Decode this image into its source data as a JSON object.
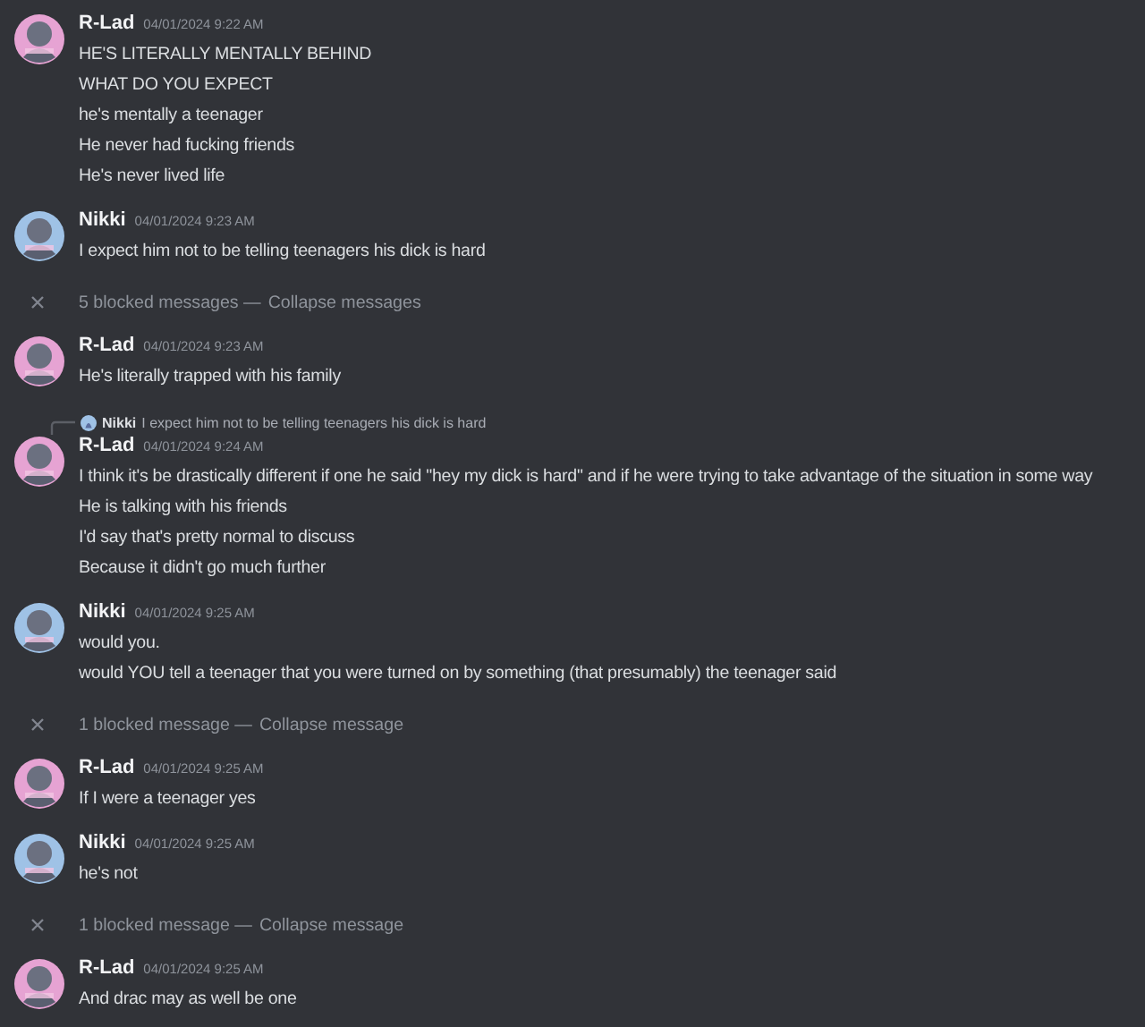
{
  "messages": [
    {
      "kind": "message",
      "author": "R-Lad",
      "timestamp": "04/01/2024 9:22 AM",
      "color": "#e6a3d3",
      "lines": [
        "HE'S LITERALLY MENTALLY BEHIND",
        "WHAT DO YOU EXPECT",
        "he's mentally a teenager",
        "He never had fucking friends",
        "He's never lived life"
      ]
    },
    {
      "kind": "message",
      "author": "Nikki",
      "timestamp": "04/01/2024 9:23 AM",
      "color": "#9fc2e6",
      "lines": [
        "I expect him not to be telling teenagers his dick is hard"
      ]
    },
    {
      "kind": "blocked",
      "label": "5 blocked messages —",
      "action": "Collapse messages"
    },
    {
      "kind": "message",
      "author": "R-Lad",
      "timestamp": "04/01/2024 9:23 AM",
      "color": "#e6a3d3",
      "lines": [
        "He's literally trapped with his family"
      ]
    },
    {
      "kind": "message",
      "author": "R-Lad",
      "timestamp": "04/01/2024 9:24 AM",
      "color": "#e6a3d3",
      "reply": {
        "author": "Nikki",
        "text": "I expect him not to be telling teenagers his dick is hard",
        "color": "#9fc2e6"
      },
      "lines": [
        "I think it's be drastically different if one he said \"hey my dick is hard\" and if he were trying to take advantage of the situation in some way",
        "He is talking with his friends",
        "I'd say that's pretty normal to discuss",
        "Because it didn't go much further"
      ]
    },
    {
      "kind": "message",
      "author": "Nikki",
      "timestamp": "04/01/2024 9:25 AM",
      "color": "#9fc2e6",
      "lines": [
        "would you.",
        "would YOU tell a teenager that you were turned on by something (that presumably) the teenager said"
      ]
    },
    {
      "kind": "blocked",
      "label": "1 blocked message —",
      "action": "Collapse message"
    },
    {
      "kind": "message",
      "author": "R-Lad",
      "timestamp": "04/01/2024 9:25 AM",
      "color": "#e6a3d3",
      "lines": [
        "If I were a teenager yes"
      ]
    },
    {
      "kind": "message",
      "author": "Nikki",
      "timestamp": "04/01/2024 9:25 AM",
      "color": "#9fc2e6",
      "lines": [
        "he's not"
      ]
    },
    {
      "kind": "blocked",
      "label": "1 blocked message —",
      "action": "Collapse message"
    },
    {
      "kind": "message",
      "author": "R-Lad",
      "timestamp": "04/01/2024 9:25 AM",
      "color": "#e6a3d3",
      "lines": [
        "And drac may as well be one"
      ]
    }
  ]
}
